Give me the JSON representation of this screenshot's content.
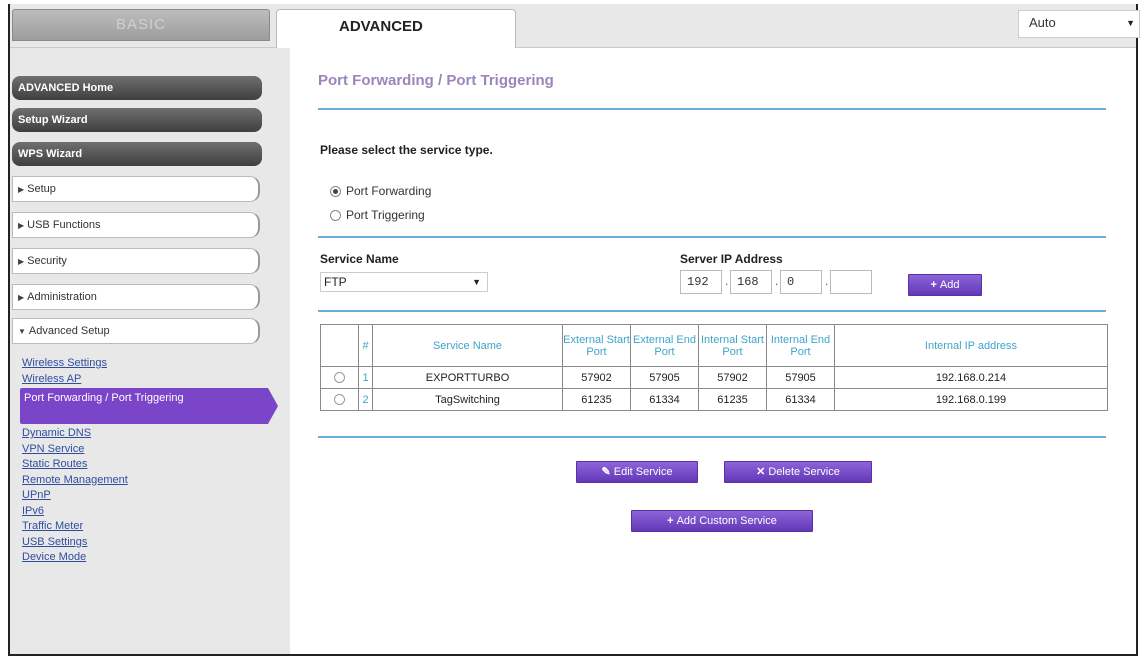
{
  "tabs": {
    "basic": "BASIC",
    "advanced": "ADVANCED"
  },
  "language": {
    "selected": "Auto"
  },
  "sidebar": {
    "main_items": [
      "ADVANCED Home",
      "Setup Wizard",
      "WPS Wizard"
    ],
    "sections": [
      "Setup",
      "USB Functions",
      "Security",
      "Administration",
      "Advanced Setup"
    ],
    "sub_items": [
      "Wireless Settings",
      "Wireless AP",
      "Port Forwarding / Port Triggering",
      "Dynamic DNS",
      "VPN Service",
      "Static Routes",
      "Remote Management",
      "UPnP",
      "IPv6",
      "Traffic Meter",
      "USB Settings",
      "Device Mode"
    ],
    "active_index": 2
  },
  "main": {
    "title": "Port Forwarding / Port Triggering",
    "select_label": "Please select the service type.",
    "radio_forwarding": "Port Forwarding",
    "radio_triggering": "Port Triggering",
    "selected_type": "Port Forwarding",
    "service_name_label": "Service Name",
    "service_name_value": "FTP",
    "server_ip_label": "Server IP Address",
    "ip": [
      "192",
      "168",
      "0",
      ""
    ],
    "add_label": "Add",
    "edit_label": "Edit Service",
    "delete_label": "Delete Service",
    "add_custom_label": "Add Custom Service"
  },
  "table": {
    "headers": [
      "",
      "#",
      "Service Name",
      "External Start Port",
      "External End Port",
      "Internal Start Port",
      "Internal End Port",
      "Internal IP address"
    ],
    "rows": [
      [
        "",
        "1",
        "EXPORTTURBO",
        "57902",
        "57905",
        "57902",
        "57905",
        "192.168.0.214"
      ],
      [
        "",
        "2",
        "TagSwitching",
        "61235",
        "61334",
        "61235",
        "61334",
        "192.168.0.199"
      ]
    ]
  },
  "colors": {
    "accent_purple": "#7b45c9",
    "rule_blue": "#6aaed6",
    "header_teal": "#3ea5c9",
    "title_lavender": "#9b85bd"
  }
}
